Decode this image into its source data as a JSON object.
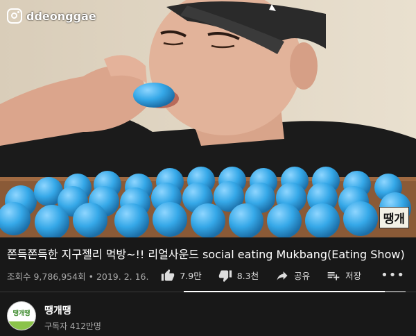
{
  "watermark": {
    "icon": "instagram-icon",
    "handle": "ddeonggae"
  },
  "video_logo_badge": "땡개",
  "title": "쫀득쫀득한 지구젤리 먹방~!! 리얼사운드 social eating Mukbang(Eating Show)",
  "meta": {
    "views": "조회수 9,786,954회",
    "separator": "•",
    "date": "2019. 2. 16."
  },
  "actions": {
    "like": {
      "icon": "thumbs-up-icon",
      "label": "7.9만"
    },
    "dislike": {
      "icon": "thumbs-down-icon",
      "label": "8.3천"
    },
    "share": {
      "icon": "share-icon",
      "label": "공유"
    },
    "save": {
      "icon": "playlist-add-icon",
      "label": "저장"
    },
    "more": "•••"
  },
  "like_ratio": 0.905,
  "channel": {
    "name": "땡개땡",
    "subscribers": "구독자 412만명",
    "avatar_text": "땡개땡"
  }
}
